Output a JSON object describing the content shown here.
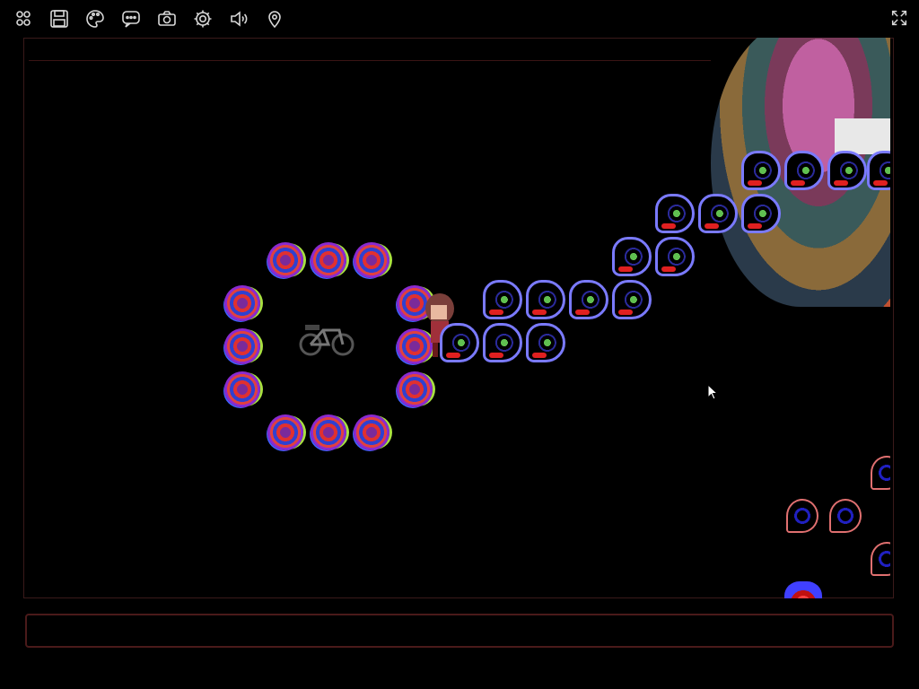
{
  "toolbar": {
    "icons": [
      "users-icon",
      "save-icon",
      "palette-icon",
      "chat-icon",
      "camera-icon",
      "settings-icon",
      "volume-icon",
      "location-pin-icon"
    ]
  },
  "fullscreen_icon": "fullscreen-icon",
  "message_box": {
    "text": ""
  },
  "colors": {
    "background": "#000000",
    "frame_border": "#3a1a1a",
    "toolbar_icon": "#d8d8d8",
    "message_border": "#4a1a1a"
  }
}
